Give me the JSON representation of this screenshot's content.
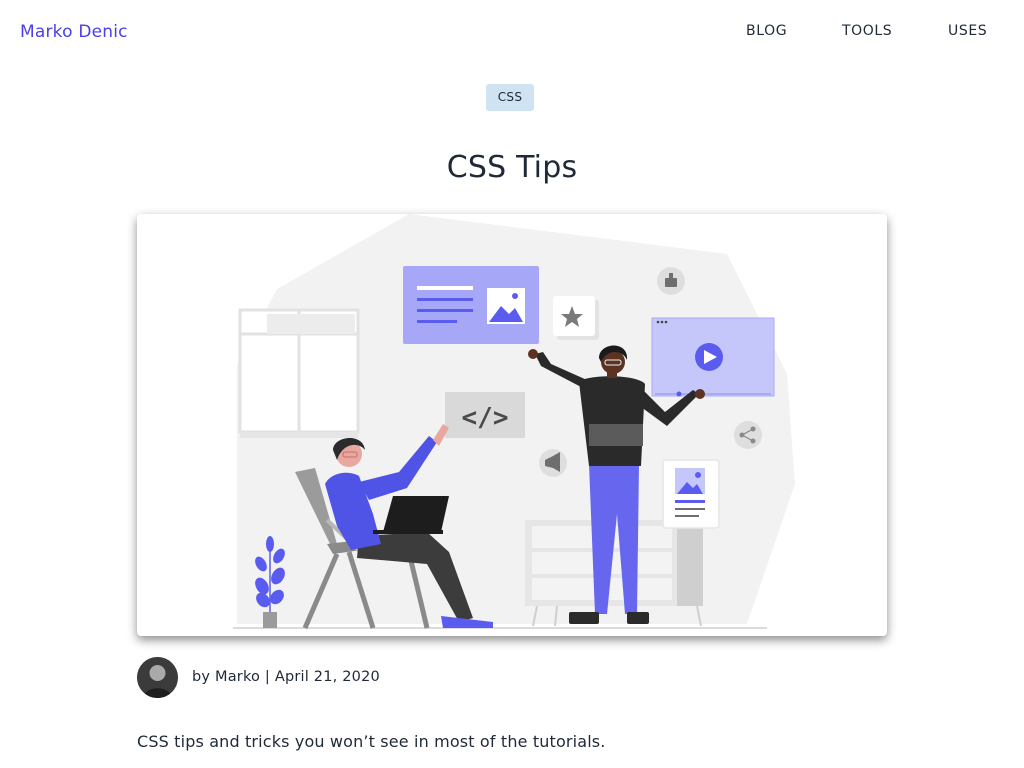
{
  "header": {
    "brand": "Marko Denic",
    "nav": {
      "blog": "BLOG",
      "tools": "TOOLS",
      "uses": "USES"
    }
  },
  "post": {
    "tag": "CSS",
    "title": "CSS Tips",
    "author_prefix": "by",
    "author": "Marko",
    "separator": "|",
    "date": "April 21, 2020",
    "intro": "CSS tips and tricks you won’t see in most of the tutorials."
  },
  "colors": {
    "brand": "#4a3fe8",
    "tag_bg": "#cfe3f3",
    "text": "#1f2937",
    "accent": "#5a5cf0"
  },
  "hero": {
    "code_glyph": "</>"
  }
}
